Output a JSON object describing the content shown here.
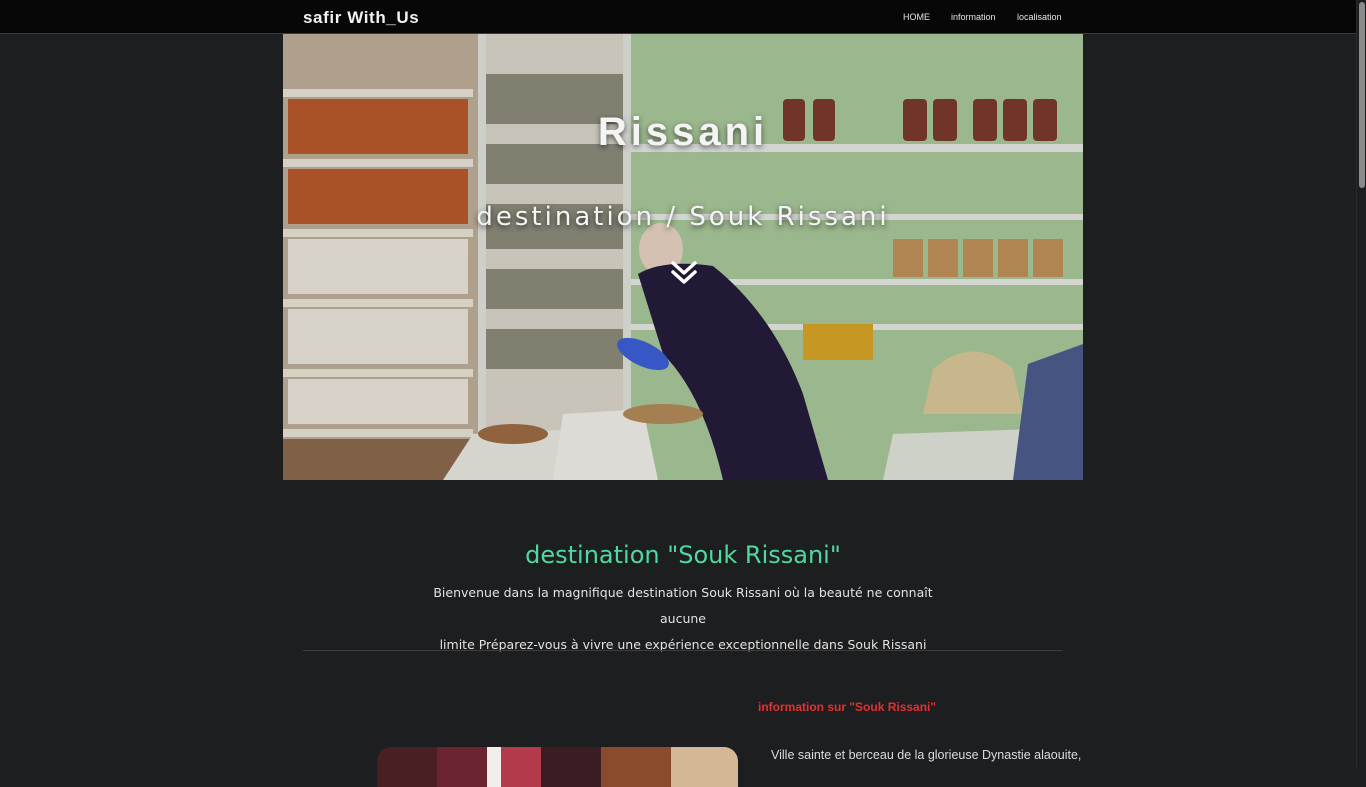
{
  "navbar": {
    "brand": "safir With_Us",
    "links": [
      "HOME",
      "information",
      "localisation"
    ]
  },
  "hero": {
    "title": "Rissani",
    "subtitle": "destination / Souk Rissani",
    "scroll_icon": "double-chevron-down-icon"
  },
  "intro": {
    "title": "destination \"Souk Rissani\"",
    "text_line1": "Bienvenue dans la magnifique destination Souk Rissani où la beauté ne connaît aucune",
    "text_line2": "limite Préparez-vous à vivre une expérience exceptionnelle dans Souk Rissani"
  },
  "info": {
    "heading": "information sur \"Souk Rissani\"",
    "paragraph_line1": "Ville sainte et berceau de la glorieuse Dynastie alaouite,"
  },
  "colors": {
    "background": "#1d1e20",
    "navbar": "#070707",
    "accent_green": "#4fd9a0",
    "accent_red": "#e63030"
  }
}
